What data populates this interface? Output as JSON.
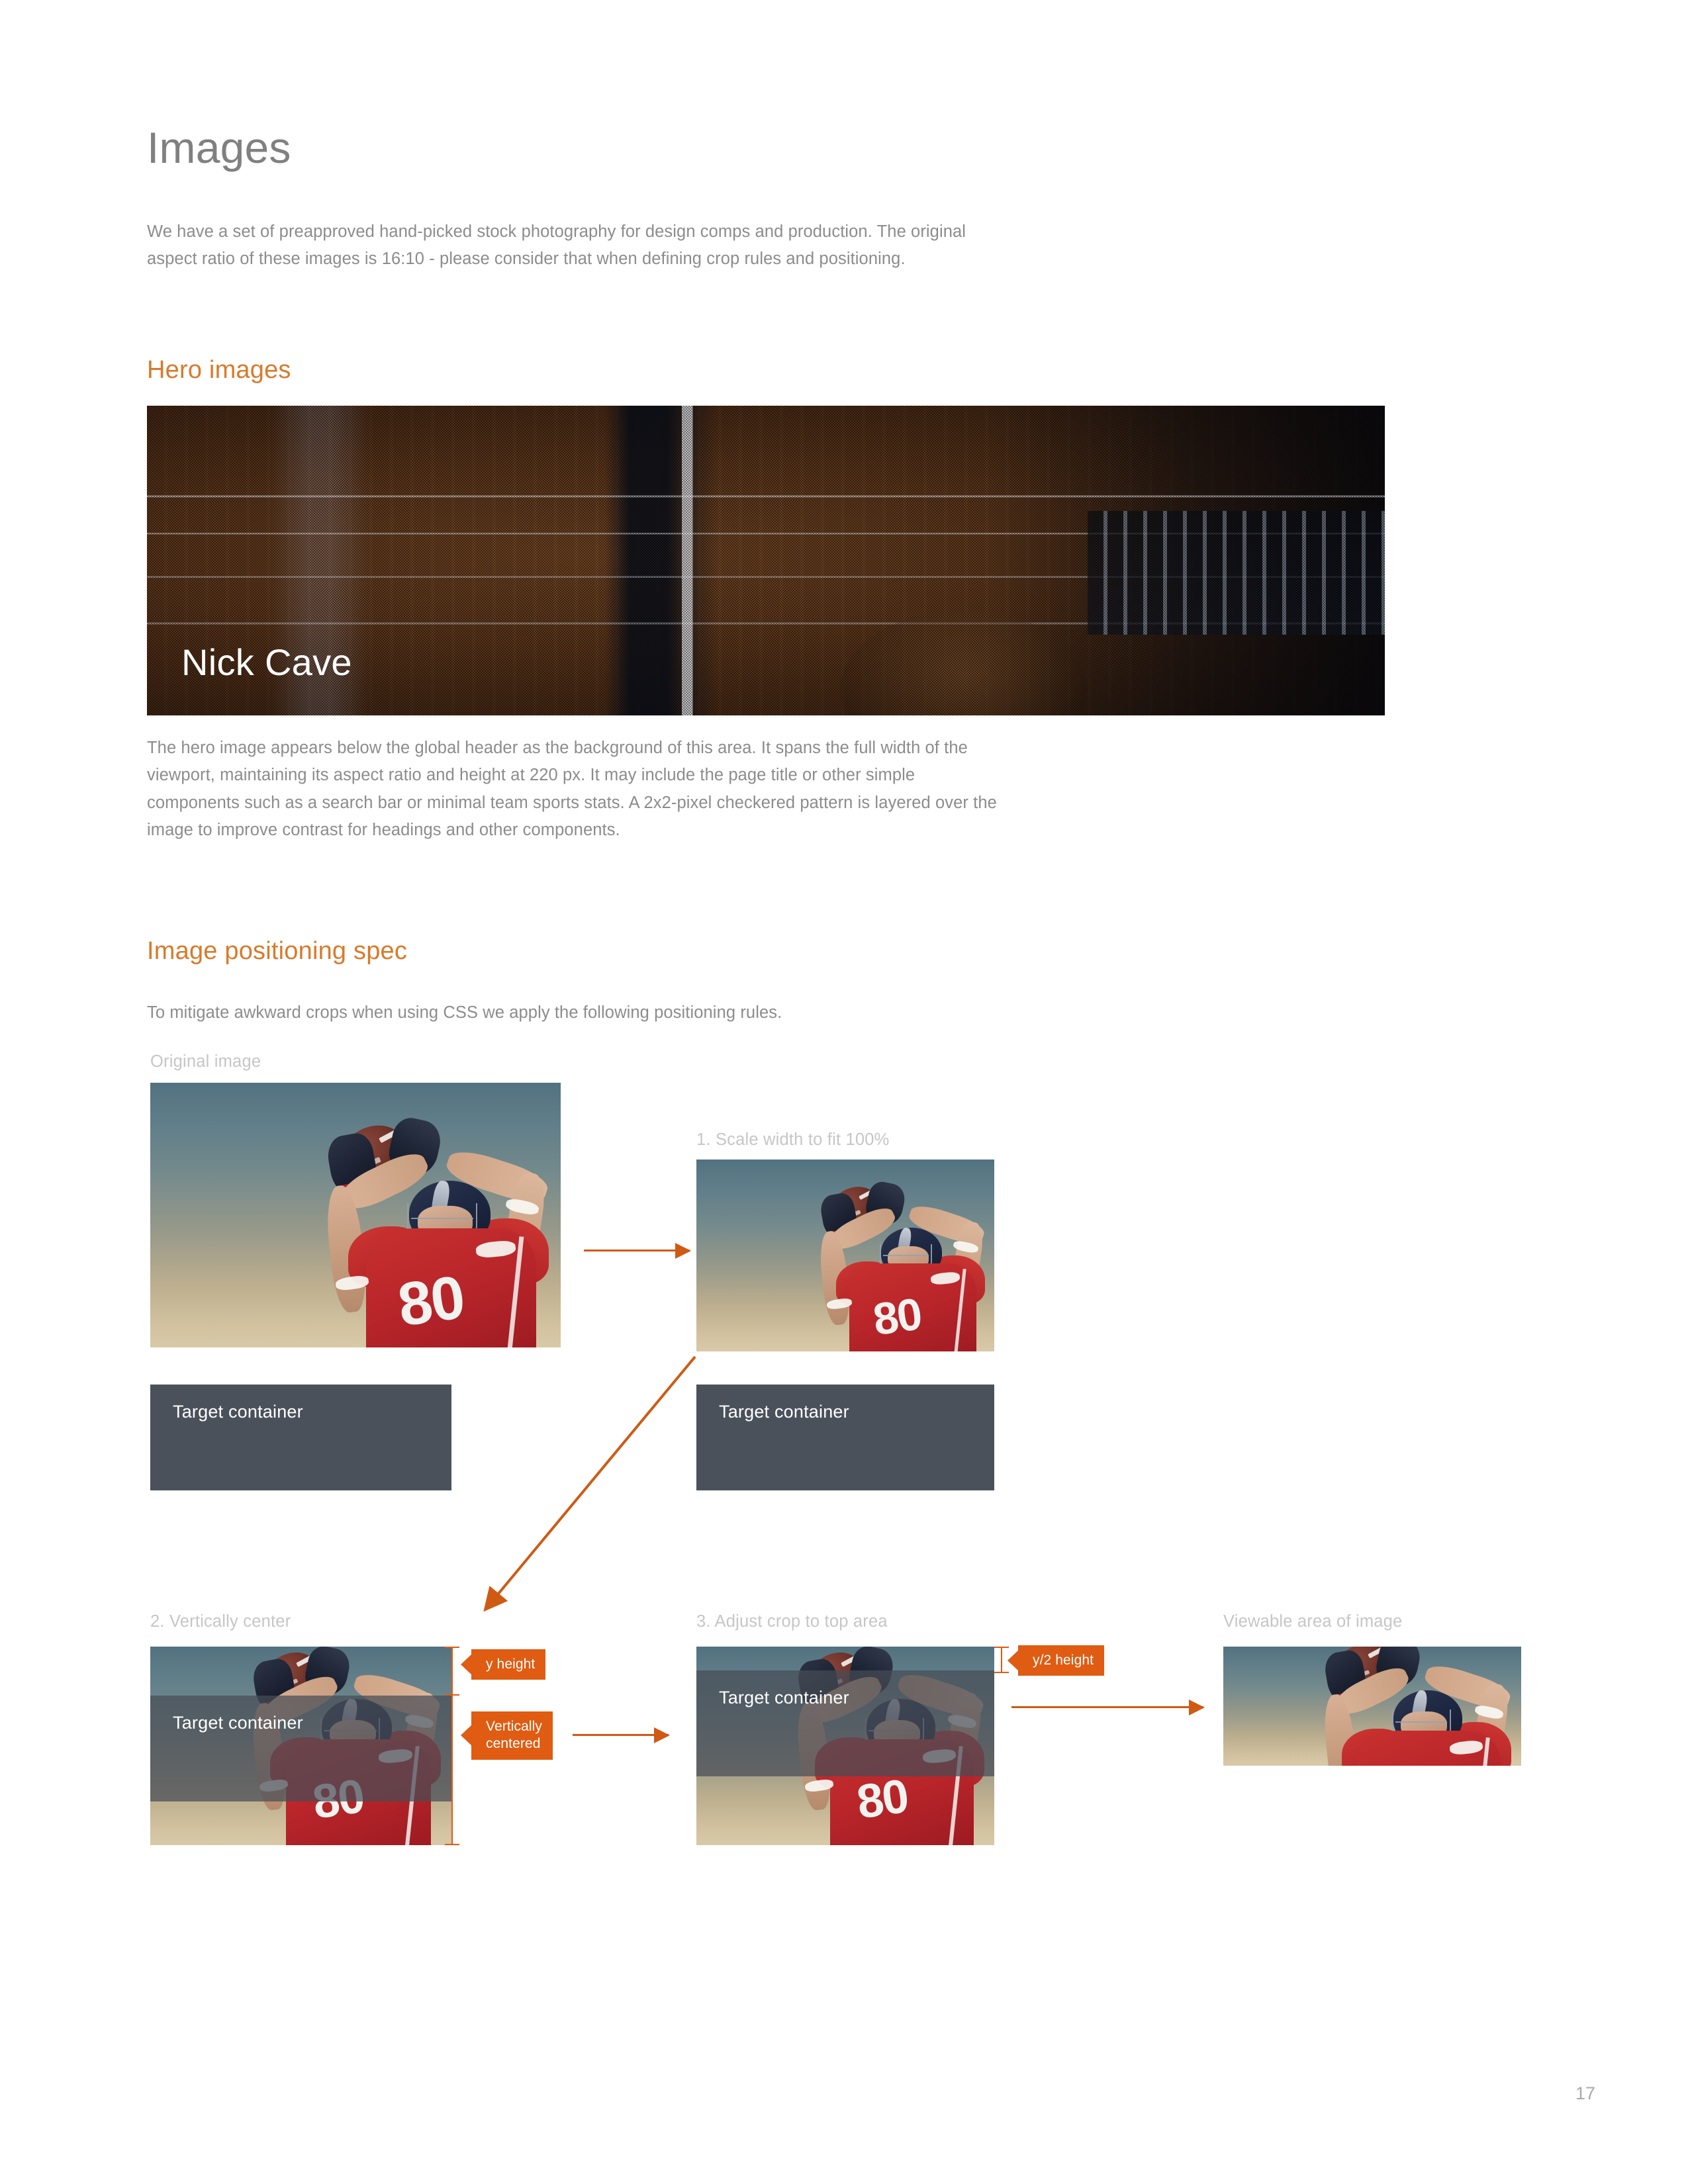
{
  "document": {
    "page_number": "17",
    "accent_color": "#d97a2b",
    "annotation_color": "#df5c12",
    "target_container_color": "#4b515b",
    "body_text_color": "#8c8c8c",
    "caption_color": "#c6c6c6"
  },
  "page_title": "Images",
  "intro_paragraph": "We have a set of preapproved hand-picked stock photography for design comps and production. The original aspect ratio of these images is 16:10 - please consider that when defining crop rules and positioning.",
  "hero_section": {
    "heading": "Hero images",
    "image_title": "Nick Cave",
    "image_subject": "acoustic-guitar-strings-photo",
    "description": "The hero image appears below the global header as the background of this area. It spans the full width of the viewport, maintaining its aspect ratio and height at 220 px. It may include the page title or other simple components such as a search bar or minimal team sports stats. A 2x2-pixel checkered pattern is layered over the image to improve contrast for headings and other components."
  },
  "spec_section": {
    "heading": "Image positioning spec",
    "intro": "To mitigate awkward crops when using CSS we apply the following positioning rules.",
    "steps": [
      {
        "id": "original",
        "caption": "Original image",
        "container_label": "Target container"
      },
      {
        "id": "step1",
        "caption": "1. Scale width to fit 100%",
        "container_label": "Target container"
      },
      {
        "id": "step2",
        "caption": "2. Vertically center",
        "container_label": "Target container"
      },
      {
        "id": "step3",
        "caption": "3. Adjust crop to top area",
        "container_label": "Target container"
      },
      {
        "id": "result",
        "caption": "Viewable area of image"
      }
    ],
    "annotations": {
      "y_height": "y height",
      "vertically_centered": "Vertically\ncentered",
      "y_half_height": "y/2 height"
    }
  }
}
